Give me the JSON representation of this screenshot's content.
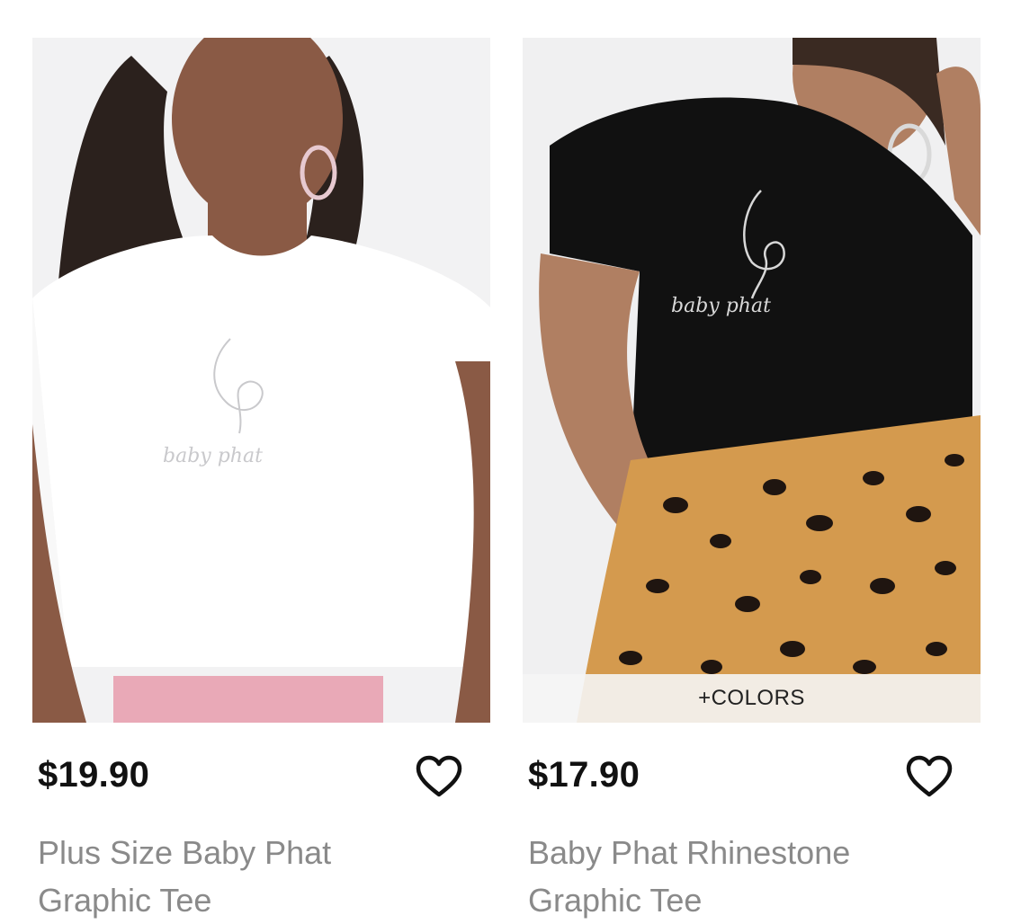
{
  "products": [
    {
      "price": "$19.90",
      "title_line1": "Plus Size Baby Phat",
      "title_line2": "Graphic Tee",
      "wishlist_icon": "heart-outline-icon"
    },
    {
      "price": "$17.90",
      "title_line1": "Baby Phat Rhinestone",
      "title_line2": "Graphic Tee",
      "colors_label": "+COLORS",
      "wishlist_icon": "heart-outline-icon"
    }
  ],
  "colors": {
    "price_text": "#111111",
    "title_text": "#8a8a8a",
    "icon_stroke": "#111111"
  }
}
